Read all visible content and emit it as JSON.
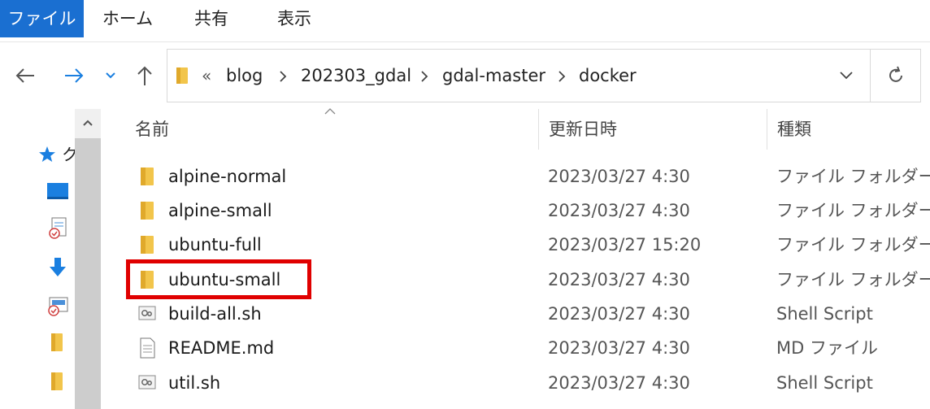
{
  "ribbon": {
    "tabs": [
      "ファイル",
      "ホーム",
      "共有",
      "表示"
    ]
  },
  "address": {
    "overflow": "«",
    "crumbs": [
      "blog",
      "202303_gdal",
      "gdal-master",
      "docker"
    ]
  },
  "left_pane": {
    "quick_access_char": "ク"
  },
  "columns": {
    "name": "名前",
    "date": "更新日時",
    "type": "種類"
  },
  "files": [
    {
      "name": "alpine-normal",
      "date": "2023/03/27 4:30",
      "type": "ファイル フォルダー",
      "icon": "folder-icon"
    },
    {
      "name": "alpine-small",
      "date": "2023/03/27 4:30",
      "type": "ファイル フォルダー",
      "icon": "folder-icon"
    },
    {
      "name": "ubuntu-full",
      "date": "2023/03/27 15:20",
      "type": "ファイル フォルダー",
      "icon": "folder-icon"
    },
    {
      "name": "ubuntu-small",
      "date": "2023/03/27 4:30",
      "type": "ファイル フォルダー",
      "icon": "folder-icon"
    },
    {
      "name": "build-all.sh",
      "date": "2023/03/27 4:30",
      "type": "Shell Script",
      "icon": "script-icon"
    },
    {
      "name": "README.md",
      "date": "2023/03/27 4:30",
      "type": "MD ファイル",
      "icon": "document-icon"
    },
    {
      "name": "util.sh",
      "date": "2023/03/27 4:30",
      "type": "Shell Script",
      "icon": "script-icon"
    }
  ],
  "colors": {
    "file_tab": "#1a6fd1",
    "highlight": "#e00000",
    "folder": "#f2c54b"
  }
}
